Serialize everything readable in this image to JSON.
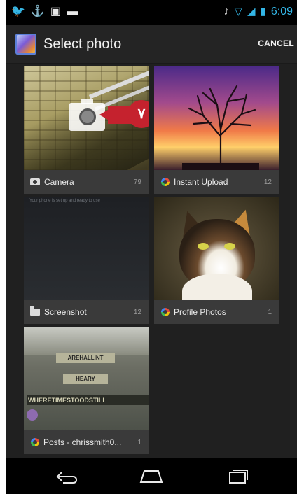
{
  "status_bar": {
    "time": "6:09",
    "left_icons": [
      "twitter-icon",
      "usb-icon",
      "gallery-icon",
      "chat-icon"
    ],
    "right_icons": [
      "mute-icon",
      "wifi-icon",
      "signal-icon",
      "battery-icon"
    ]
  },
  "action_bar": {
    "title": "Select photo",
    "cancel_label": "CANCEL"
  },
  "albums": [
    {
      "name": "Camera",
      "count": "79",
      "icon": "camera-icon"
    },
    {
      "name": "Instant Upload",
      "count": "12",
      "icon": "google-plus-icon"
    },
    {
      "name": "Screenshot",
      "count": "12",
      "icon": "folder-icon"
    },
    {
      "name": "Profile Photos",
      "count": "1",
      "icon": "google-plus-icon"
    },
    {
      "name": "Posts - chrissmith0...",
      "count": "1",
      "icon": "google-plus-icon"
    }
  ],
  "screenshot_preview_text": "Your phone is set up and ready to use",
  "callout_number": "٧",
  "sign_texts": [
    "AREHALLINT",
    "HEARY",
    "WHERETIMESTOODSTILL"
  ],
  "colors": {
    "accent": "#33b5e5",
    "callout": "#c5222e"
  }
}
